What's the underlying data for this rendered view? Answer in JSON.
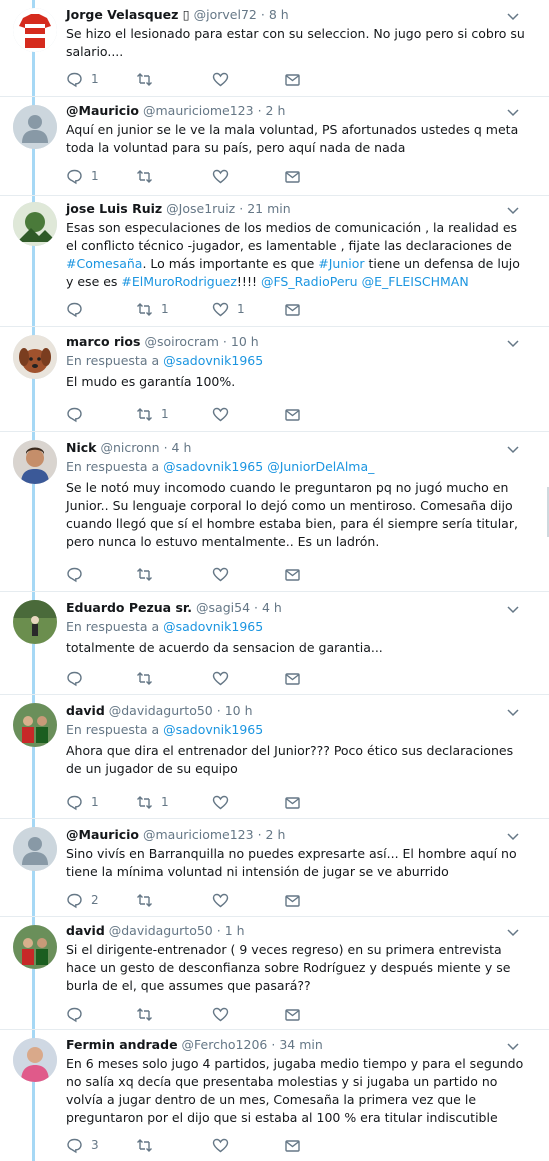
{
  "colors": {
    "link": "#1b95e0",
    "muted": "#657786",
    "thread": "#a6d8f5"
  },
  "tweets": [
    {
      "name": "Jorge Velasquez ▯",
      "handle": "@jorvel72",
      "time": "8 h",
      "avatar_icon": "paraguay-jersey-avatar",
      "text": "Se hizo el lesionado para estar con su seleccion. No jugo pero si cobro su salario....",
      "replies": "1",
      "retweets": "",
      "likes": ""
    },
    {
      "name": "@Mauricio",
      "handle": "@mauriciome123",
      "time": "2 h",
      "avatar_icon": "default-user-avatar",
      "text": "Aquí en junior se le ve la mala voluntad, PS afortunados ustedes q meta toda la voluntad para su país, pero aquí nada de nada",
      "replies": "1",
      "retweets": "",
      "likes": ""
    },
    {
      "name": "jose Luis Ruiz",
      "handle": "@Jose1ruiz",
      "time": "21 min",
      "avatar_icon": "photo-avatar",
      "text_parts": [
        "Esas son especulaciones de los medios de comunicación , la realidad es el conflicto técnico -jugador, es lamentable , fijate las declaraciones de ",
        "#Comesaña",
        ". Lo más importante es que ",
        "#Junior",
        " tiene un defensa de lujo y ese es ",
        "#ElMuroRodriguez",
        "!!!! ",
        "@FS_RadioPeru",
        " ",
        "@E_FLEISCHMAN"
      ],
      "replies": "",
      "retweets": "1",
      "likes": "1"
    },
    {
      "name": "marco rios",
      "handle": "@soirocram",
      "time": "10 h",
      "avatar_icon": "dog-avatar",
      "reply_label": "En respuesta a",
      "reply_to": "@sadovnik1965",
      "text": "El mudo es garantía 100%.",
      "replies": "",
      "retweets": "1",
      "likes": ""
    },
    {
      "name": "Nick",
      "handle": "@nicronn",
      "time": "4 h",
      "avatar_icon": "man-avatar",
      "reply_label": "En respuesta a",
      "reply_to": "@sadovnik1965",
      "reply_to_2": "@JuniorDelAlma_",
      "text": "Se le notó muy incomodo cuando le preguntaron pq no jugó mucho en Junior.. Su lenguaje corporal lo dejó como un mentiroso. Comesaña dijo cuando llegó que sí el hombre estaba bien, para él siempre sería titular, pero nunca lo estuvo mentalmente.. Es un ladrón.",
      "replies": "",
      "retweets": "",
      "likes": ""
    },
    {
      "name": "Eduardo Pezua sr.",
      "handle": "@sagi54",
      "time": "4 h",
      "avatar_icon": "field-avatar",
      "reply_label": "En respuesta a",
      "reply_to": "@sadovnik1965",
      "text": "totalmente de acuerdo da sensacion de garantia...",
      "replies": "",
      "retweets": "",
      "likes": ""
    },
    {
      "name": "david",
      "handle": "@davidagurto50",
      "time": "10 h",
      "avatar_icon": "team-avatar",
      "reply_label": "En respuesta a",
      "reply_to": "@sadovnik1965",
      "text": "Ahora que dira el entrenador del Junior??? Poco ético sus declaraciones de un jugador de su equipo",
      "replies": "1",
      "retweets": "1",
      "likes": ""
    },
    {
      "name": "@Mauricio",
      "handle": "@mauriciome123",
      "time": "2 h",
      "avatar_icon": "default-user-avatar",
      "text": "Sino vivís en Barranquilla no puedes expresarte así... El hombre aquí no tiene la mínima voluntad ni intensión de jugar se ve aburrido",
      "replies": "2",
      "retweets": "",
      "likes": ""
    },
    {
      "name": "david",
      "handle": "@davidagurto50",
      "time": "1 h",
      "avatar_icon": "team-avatar",
      "text": "Si el dirigente-entrenador ( 9 veces regreso) en su primera entrevista hace un gesto de desconfianza sobre Rodríguez y después miente y se burla de el, que assumes que pasará??",
      "replies": "",
      "retweets": "",
      "likes": ""
    },
    {
      "name": "Fermin andrade",
      "handle": "@Fercho1206",
      "time": "34 min",
      "avatar_icon": "person-avatar",
      "text": "En 6 meses solo jugo 4 partidos, jugaba medio tiempo y para el segundo no salía xq decía que presentaba molestias y si jugaba un partido no volvía a jugar dentro de un mes, Comesaña la primera vez que le preguntaron por el dijo que si estaba al 100 % era titular indiscutible",
      "replies": "3",
      "retweets": "",
      "likes": ""
    }
  ]
}
